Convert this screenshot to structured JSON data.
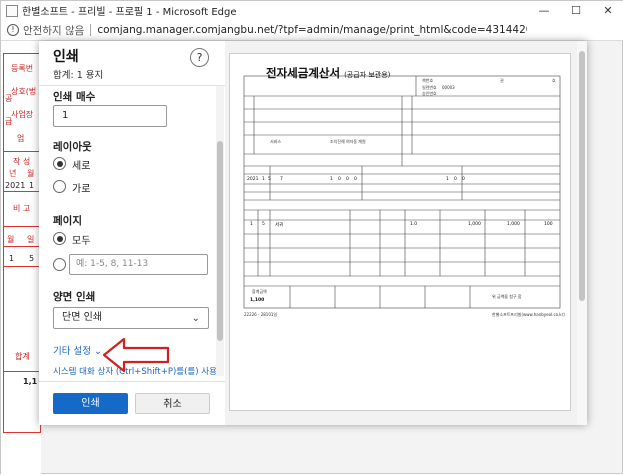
{
  "window": {
    "title": "한별소프트 - 프리빌 - 프로필 1 - Microsoft Edge",
    "minimize": "—",
    "restore": "☐",
    "close": "✕"
  },
  "address": {
    "security_label": "안전하지 않음",
    "url": "comjang.manager.comjangbu.net/?tpf=admin/manage/print_html&code=43144204&is_email=n&receive_type=s..."
  },
  "background_page": {
    "cells": [
      "등록번",
      "상호(법",
      "공",
      "사업장",
      "급",
      "업",
      "작 성",
      "년",
      "월",
      "2021",
      "1",
      "비 고",
      "월",
      "일",
      "1",
      "5",
      "합계",
      "1,1"
    ]
  },
  "print_dialog": {
    "title": "인쇄",
    "summary": "합계: 1 용지",
    "help": "?",
    "copies": {
      "label": "인쇄 매수",
      "value": "1"
    },
    "layout": {
      "label": "레이아웃",
      "options": [
        "세로",
        "가로"
      ],
      "selected": "세로"
    },
    "pages": {
      "label": "페이지",
      "all": "모두",
      "custom_placeholder": "예: 1-5, 8, 11-13"
    },
    "duplex": {
      "label": "양면 인쇄",
      "value": "단면 인쇄"
    },
    "more_settings": "기타 설정",
    "system_dialog": "시스템 대화 상자 (Ctrl+Shift+P)를(를) 사용하여",
    "print_button": "인쇄",
    "cancel_button": "취소"
  },
  "preview": {
    "doc_title": "전자세금계산서",
    "doc_subtitle": "(공급자 보관용)",
    "book_no": "책번호",
    "book_vol": "권",
    "book_ho": "호",
    "serial_label": "일련번호",
    "serial_value": "00003",
    "approval_label": "승인번호",
    "supplier_name": "서비스",
    "supplier_addr": "조치진해 여자동 계원",
    "year": "2021",
    "month": "1",
    "day": "5",
    "blank_count": "7",
    "supply_digits": [
      "1",
      "0",
      "0",
      "0"
    ],
    "tax_digits": [
      "1",
      "0",
      "0"
    ],
    "item_month": "1",
    "item_day": "5",
    "item_name": "서귀",
    "qty": "1.0",
    "unit_price": "1,000",
    "supply_amount": "1,000",
    "tax_amount": "100",
    "total_label": "합계금액",
    "total_value": "1,100",
    "claim_text": "위 금액을 청구 함",
    "footer_left": "22226 - 28101일",
    "footer_right": "한별소프트프리빌(www.hanbyeol.co.kr)"
  },
  "colors": {
    "accent": "#1569c7",
    "arrow": "#d02020",
    "invoice_red": "#d33333"
  }
}
